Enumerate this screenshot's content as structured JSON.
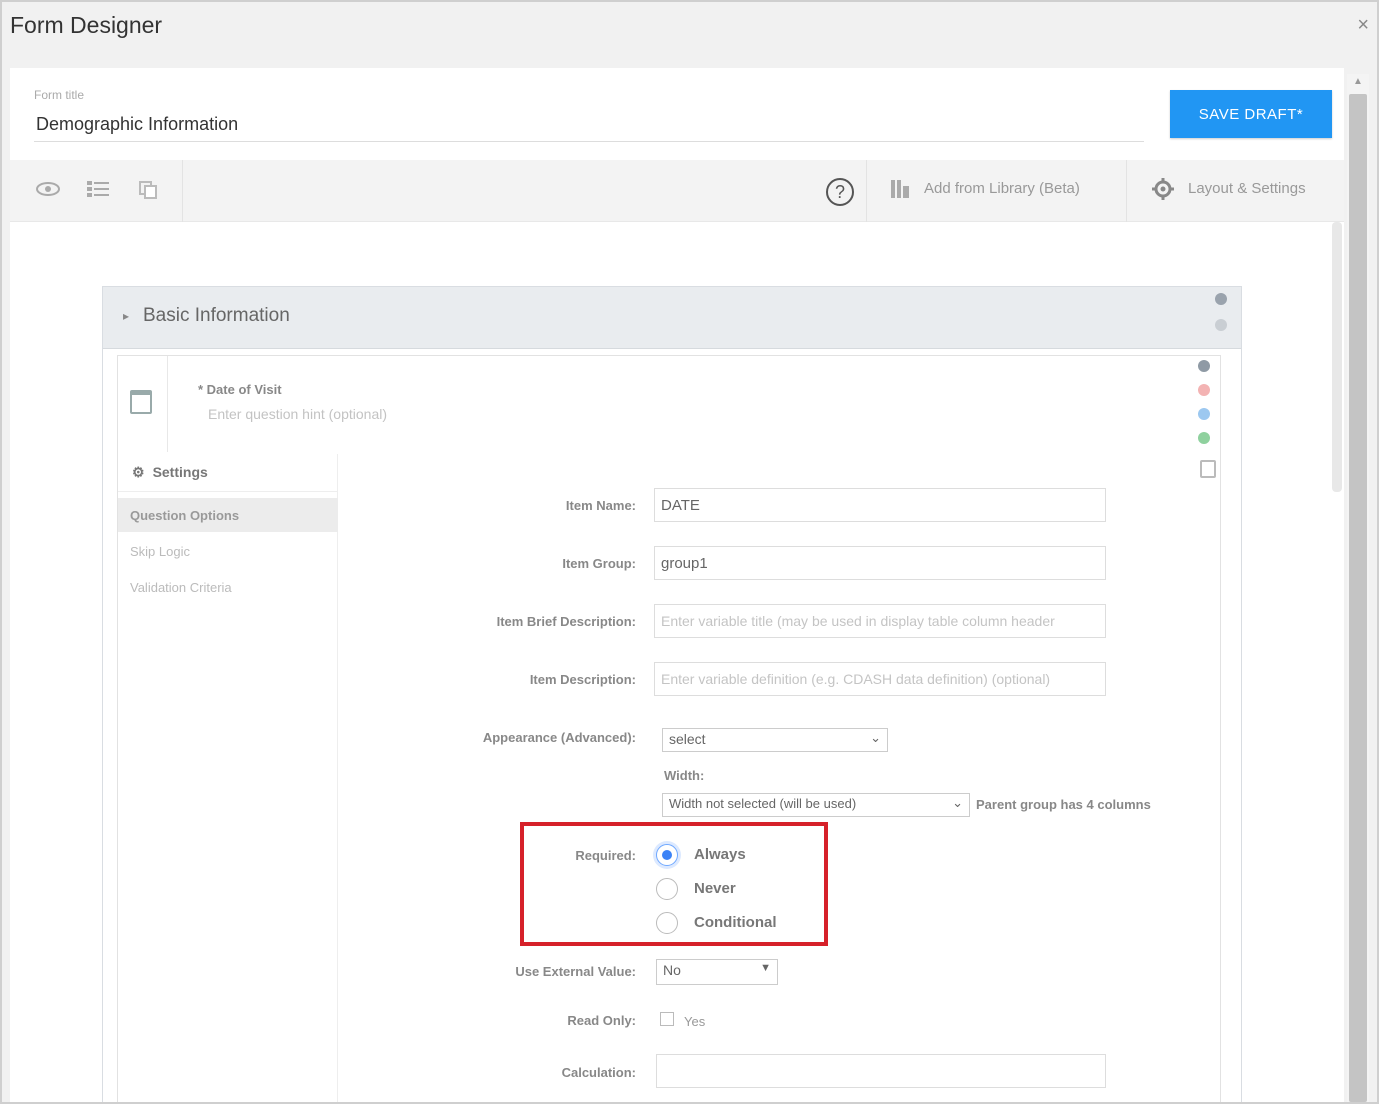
{
  "window": {
    "title": "Form Designer",
    "close_glyph": "×"
  },
  "form": {
    "title_label": "Form title",
    "title_value": "Demographic Information",
    "save_label": "SAVE DRAFT*"
  },
  "toolbar": {
    "help_glyph": "?",
    "add_library_label": "Add from Library (Beta)",
    "layout_settings_label": "Layout & Settings"
  },
  "section": {
    "title": "Basic Information"
  },
  "question": {
    "title": "* Date of Visit",
    "subtitle_placeholder": "Enter question hint (optional)"
  },
  "settings_nav": {
    "header": "Settings",
    "items": [
      "Question Options",
      "Skip Logic",
      "Validation Criteria"
    ]
  },
  "fields": {
    "item_name": {
      "label": "Item Name:",
      "value": "DATE"
    },
    "item_group": {
      "label": "Item Group:",
      "value": "group1"
    },
    "item_brief": {
      "label": "Item Brief Description:",
      "placeholder": "Enter variable title (may be used in display table column header"
    },
    "item_description": {
      "label": "Item Description:",
      "placeholder": "Enter variable definition (e.g. CDASH data definition) (optional)"
    },
    "appearance": {
      "label": "Appearance (Advanced):",
      "value": "select"
    },
    "width": {
      "label": "Width:",
      "value": "Width not selected (will be used)",
      "note": "Parent group has 4 columns"
    },
    "required": {
      "label": "Required:",
      "options": [
        "Always",
        "Never",
        "Conditional"
      ],
      "selected": "Always"
    },
    "use_external": {
      "label": "Use External Value:",
      "value": "No"
    },
    "read_only": {
      "label": "Read Only:",
      "option": "Yes"
    },
    "calculation": {
      "label": "Calculation:",
      "value": ""
    }
  },
  "colors": {
    "primary": "#2196f3",
    "highlight": "#d6212a"
  }
}
